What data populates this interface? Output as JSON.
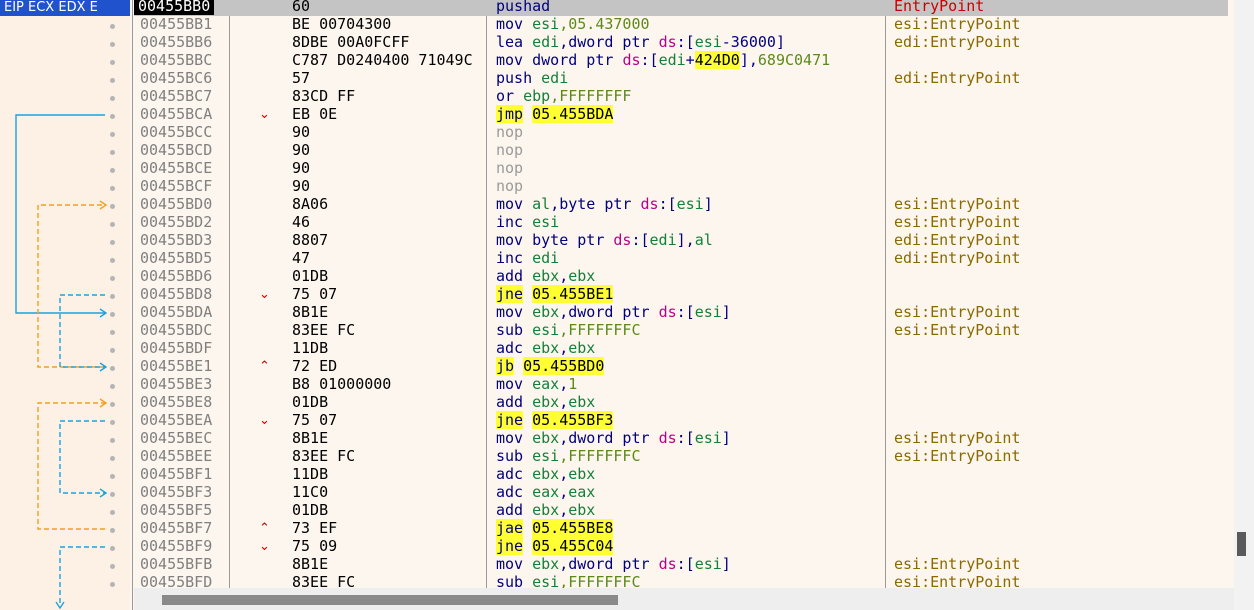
{
  "header": {
    "registers_label": "EIP ECX EDX E"
  },
  "colors": {
    "jump_solid": "#1aa3e0",
    "jump_orange": "#f0a020",
    "jump_dashed_blue": "#1aa3e0"
  },
  "rows": [
    {
      "addr": "00455BB0",
      "hex": "60",
      "arrow": "",
      "dis": [
        {
          "t": "pushad",
          "c": "mn"
        }
      ],
      "cmt": "EntryPoint",
      "cmtc": "red",
      "sel": true,
      "cur": true
    },
    {
      "addr": "00455BB1",
      "hex": "BE 00704300",
      "arrow": "",
      "dis": [
        {
          "t": "mov ",
          "c": "mn"
        },
        {
          "t": "esi",
          "c": "reg"
        },
        {
          "t": ",05.437000",
          "c": "num"
        }
      ],
      "cmt": "esi:EntryPoint"
    },
    {
      "addr": "00455BB6",
      "hex": "8DBE 00A0FCFF",
      "arrow": "",
      "dis": [
        {
          "t": "lea ",
          "c": "mn"
        },
        {
          "t": "edi",
          "c": "reg"
        },
        {
          "t": ",dword ptr ",
          "c": "mn"
        },
        {
          "t": "ds",
          "c": "seg"
        },
        {
          "t": ":[",
          "c": "mn"
        },
        {
          "t": "esi",
          "c": "reg"
        },
        {
          "t": "-36000]",
          "c": "mn"
        }
      ],
      "cmt": "edi:EntryPoint"
    },
    {
      "addr": "00455BBC",
      "hex": "C787 D0240400 71049C",
      "arrow": "",
      "dis": [
        {
          "t": "mov dword ptr ",
          "c": "mn"
        },
        {
          "t": "ds",
          "c": "seg"
        },
        {
          "t": ":[",
          "c": "mn"
        },
        {
          "t": "edi",
          "c": "reg"
        },
        {
          "t": "+",
          "c": "mn"
        },
        {
          "t": "424D0",
          "c": "hl"
        },
        {
          "t": "],",
          "c": "mn"
        },
        {
          "t": "689C0471",
          "c": "num"
        }
      ],
      "cmt": ""
    },
    {
      "addr": "00455BC6",
      "hex": "57",
      "arrow": "",
      "dis": [
        {
          "t": "push ",
          "c": "mn"
        },
        {
          "t": "edi",
          "c": "reg"
        }
      ],
      "cmt": "edi:EntryPoint"
    },
    {
      "addr": "00455BC7",
      "hex": "83CD FF",
      "arrow": "",
      "dis": [
        {
          "t": "or ",
          "c": "mn"
        },
        {
          "t": "ebp",
          "c": "reg"
        },
        {
          "t": ",FFFFFFFF",
          "c": "num"
        }
      ],
      "cmt": ""
    },
    {
      "addr": "00455BCA",
      "hex": "EB 0E",
      "arrow": "down",
      "dis": [
        {
          "t": "jmp",
          "c": "jmp"
        },
        {
          "t": " ",
          "c": "mn"
        },
        {
          "t": "05.455BDA",
          "c": "hl"
        }
      ],
      "cmt": ""
    },
    {
      "addr": "00455BCC",
      "hex": "90",
      "arrow": "",
      "dis": [
        {
          "t": "nop",
          "c": "nop"
        }
      ],
      "cmt": ""
    },
    {
      "addr": "00455BCD",
      "hex": "90",
      "arrow": "",
      "dis": [
        {
          "t": "nop",
          "c": "nop"
        }
      ],
      "cmt": ""
    },
    {
      "addr": "00455BCE",
      "hex": "90",
      "arrow": "",
      "dis": [
        {
          "t": "nop",
          "c": "nop"
        }
      ],
      "cmt": ""
    },
    {
      "addr": "00455BCF",
      "hex": "90",
      "arrow": "",
      "dis": [
        {
          "t": "nop",
          "c": "nop"
        }
      ],
      "cmt": ""
    },
    {
      "addr": "00455BD0",
      "hex": "8A06",
      "arrow": "",
      "dis": [
        {
          "t": "mov ",
          "c": "mn"
        },
        {
          "t": "al",
          "c": "reg"
        },
        {
          "t": ",byte ptr ",
          "c": "mn"
        },
        {
          "t": "ds",
          "c": "seg"
        },
        {
          "t": ":[",
          "c": "mn"
        },
        {
          "t": "esi",
          "c": "reg"
        },
        {
          "t": "]",
          "c": "mn"
        }
      ],
      "cmt": "esi:EntryPoint"
    },
    {
      "addr": "00455BD2",
      "hex": "46",
      "arrow": "",
      "dis": [
        {
          "t": "inc ",
          "c": "mn"
        },
        {
          "t": "esi",
          "c": "reg"
        }
      ],
      "cmt": "esi:EntryPoint"
    },
    {
      "addr": "00455BD3",
      "hex": "8807",
      "arrow": "",
      "dis": [
        {
          "t": "mov byte ptr ",
          "c": "mn"
        },
        {
          "t": "ds",
          "c": "seg"
        },
        {
          "t": ":[",
          "c": "mn"
        },
        {
          "t": "edi",
          "c": "reg"
        },
        {
          "t": "],",
          "c": "mn"
        },
        {
          "t": "al",
          "c": "reg"
        }
      ],
      "cmt": "edi:EntryPoint"
    },
    {
      "addr": "00455BD5",
      "hex": "47",
      "arrow": "",
      "dis": [
        {
          "t": "inc ",
          "c": "mn"
        },
        {
          "t": "edi",
          "c": "reg"
        }
      ],
      "cmt": "edi:EntryPoint"
    },
    {
      "addr": "00455BD6",
      "hex": "01DB",
      "arrow": "",
      "dis": [
        {
          "t": "add ",
          "c": "mn"
        },
        {
          "t": "ebx",
          "c": "reg"
        },
        {
          "t": ",",
          "c": "mn"
        },
        {
          "t": "ebx",
          "c": "reg"
        }
      ],
      "cmt": ""
    },
    {
      "addr": "00455BD8",
      "hex": "75 07",
      "arrow": "down",
      "dis": [
        {
          "t": "jne",
          "c": "jmp"
        },
        {
          "t": " ",
          "c": "mn"
        },
        {
          "t": "05.455BE1",
          "c": "hl"
        }
      ],
      "cmt": ""
    },
    {
      "addr": "00455BDA",
      "hex": "8B1E",
      "arrow": "",
      "dis": [
        {
          "t": "mov ",
          "c": "mn"
        },
        {
          "t": "ebx",
          "c": "reg"
        },
        {
          "t": ",dword ptr ",
          "c": "mn"
        },
        {
          "t": "ds",
          "c": "seg"
        },
        {
          "t": ":[",
          "c": "mn"
        },
        {
          "t": "esi",
          "c": "reg"
        },
        {
          "t": "]",
          "c": "mn"
        }
      ],
      "cmt": "esi:EntryPoint"
    },
    {
      "addr": "00455BDC",
      "hex": "83EE FC",
      "arrow": "",
      "dis": [
        {
          "t": "sub ",
          "c": "mn"
        },
        {
          "t": "esi",
          "c": "reg"
        },
        {
          "t": ",FFFFFFFC",
          "c": "num"
        }
      ],
      "cmt": "esi:EntryPoint"
    },
    {
      "addr": "00455BDF",
      "hex": "11DB",
      "arrow": "",
      "dis": [
        {
          "t": "adc ",
          "c": "mn"
        },
        {
          "t": "ebx",
          "c": "reg"
        },
        {
          "t": ",",
          "c": "mn"
        },
        {
          "t": "ebx",
          "c": "reg"
        }
      ],
      "cmt": ""
    },
    {
      "addr": "00455BE1",
      "hex": "72 ED",
      "arrow": "up",
      "dis": [
        {
          "t": "jb",
          "c": "jmp"
        },
        {
          "t": " ",
          "c": "mn"
        },
        {
          "t": "05.455BD0",
          "c": "hl"
        }
      ],
      "cmt": ""
    },
    {
      "addr": "00455BE3",
      "hex": "B8 01000000",
      "arrow": "",
      "dis": [
        {
          "t": "mov ",
          "c": "mn"
        },
        {
          "t": "eax",
          "c": "reg"
        },
        {
          "t": ",",
          "c": "mn"
        },
        {
          "t": "1",
          "c": "num"
        }
      ],
      "cmt": ""
    },
    {
      "addr": "00455BE8",
      "hex": "01DB",
      "arrow": "",
      "dis": [
        {
          "t": "add ",
          "c": "mn"
        },
        {
          "t": "ebx",
          "c": "reg"
        },
        {
          "t": ",",
          "c": "mn"
        },
        {
          "t": "ebx",
          "c": "reg"
        }
      ],
      "cmt": ""
    },
    {
      "addr": "00455BEA",
      "hex": "75 07",
      "arrow": "down",
      "dis": [
        {
          "t": "jne",
          "c": "jmp"
        },
        {
          "t": " ",
          "c": "mn"
        },
        {
          "t": "05.455BF3",
          "c": "hl"
        }
      ],
      "cmt": ""
    },
    {
      "addr": "00455BEC",
      "hex": "8B1E",
      "arrow": "",
      "dis": [
        {
          "t": "mov ",
          "c": "mn"
        },
        {
          "t": "ebx",
          "c": "reg"
        },
        {
          "t": ",dword ptr ",
          "c": "mn"
        },
        {
          "t": "ds",
          "c": "seg"
        },
        {
          "t": ":[",
          "c": "mn"
        },
        {
          "t": "esi",
          "c": "reg"
        },
        {
          "t": "]",
          "c": "mn"
        }
      ],
      "cmt": "esi:EntryPoint"
    },
    {
      "addr": "00455BEE",
      "hex": "83EE FC",
      "arrow": "",
      "dis": [
        {
          "t": "sub ",
          "c": "mn"
        },
        {
          "t": "esi",
          "c": "reg"
        },
        {
          "t": ",FFFFFFFC",
          "c": "num"
        }
      ],
      "cmt": "esi:EntryPoint"
    },
    {
      "addr": "00455BF1",
      "hex": "11DB",
      "arrow": "",
      "dis": [
        {
          "t": "adc ",
          "c": "mn"
        },
        {
          "t": "ebx",
          "c": "reg"
        },
        {
          "t": ",",
          "c": "mn"
        },
        {
          "t": "ebx",
          "c": "reg"
        }
      ],
      "cmt": ""
    },
    {
      "addr": "00455BF3",
      "hex": "11C0",
      "arrow": "",
      "dis": [
        {
          "t": "adc ",
          "c": "mn"
        },
        {
          "t": "eax",
          "c": "reg"
        },
        {
          "t": ",",
          "c": "mn"
        },
        {
          "t": "eax",
          "c": "reg"
        }
      ],
      "cmt": ""
    },
    {
      "addr": "00455BF5",
      "hex": "01DB",
      "arrow": "",
      "dis": [
        {
          "t": "add ",
          "c": "mn"
        },
        {
          "t": "ebx",
          "c": "reg"
        },
        {
          "t": ",",
          "c": "mn"
        },
        {
          "t": "ebx",
          "c": "reg"
        }
      ],
      "cmt": ""
    },
    {
      "addr": "00455BF7",
      "hex": "73 EF",
      "arrow": "up",
      "dis": [
        {
          "t": "jae",
          "c": "jmp"
        },
        {
          "t": " ",
          "c": "mn"
        },
        {
          "t": "05.455BE8",
          "c": "hl"
        }
      ],
      "cmt": ""
    },
    {
      "addr": "00455BF9",
      "hex": "75 09",
      "arrow": "down",
      "dis": [
        {
          "t": "jne",
          "c": "jmp"
        },
        {
          "t": " ",
          "c": "mn"
        },
        {
          "t": "05.455C04",
          "c": "hl"
        }
      ],
      "cmt": ""
    },
    {
      "addr": "00455BFB",
      "hex": "8B1E",
      "arrow": "",
      "dis": [
        {
          "t": "mov ",
          "c": "mn"
        },
        {
          "t": "ebx",
          "c": "reg"
        },
        {
          "t": ",dword ptr ",
          "c": "mn"
        },
        {
          "t": "ds",
          "c": "seg"
        },
        {
          "t": ":[",
          "c": "mn"
        },
        {
          "t": "esi",
          "c": "reg"
        },
        {
          "t": "]",
          "c": "mn"
        }
      ],
      "cmt": "esi:EntryPoint"
    },
    {
      "addr": "00455BFD",
      "hex": "83EE FC",
      "arrow": "",
      "dis": [
        {
          "t": "sub ",
          "c": "mn"
        },
        {
          "t": "esi",
          "c": "reg"
        },
        {
          "t": ",FFFFFFFC",
          "c": "num"
        }
      ],
      "cmt": "esi:EntryPoint"
    }
  ],
  "arrow_glyphs": {
    "up": "⌃",
    "down": "⌄"
  }
}
